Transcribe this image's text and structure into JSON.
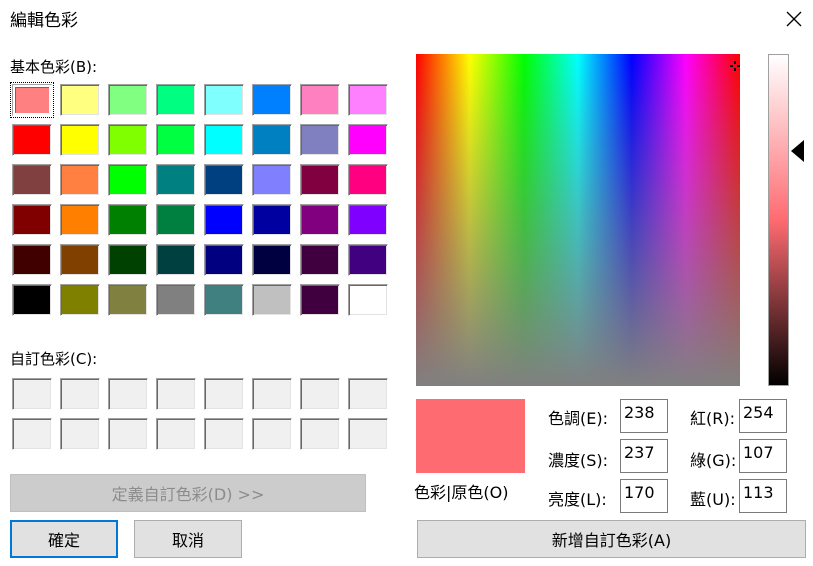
{
  "dialog": {
    "title": "編輯色彩"
  },
  "basic_colors": {
    "label": "基本色彩(B):",
    "rows": [
      [
        "#ff8080",
        "#ffff80",
        "#80ff80",
        "#00ff80",
        "#80ffff",
        "#0080ff",
        "#ff80c0",
        "#ff80ff"
      ],
      [
        "#ff0000",
        "#ffff00",
        "#80ff00",
        "#00ff40",
        "#00ffff",
        "#0080c0",
        "#8080c0",
        "#ff00ff"
      ],
      [
        "#804040",
        "#ff8040",
        "#00ff00",
        "#008080",
        "#004080",
        "#8080ff",
        "#800040",
        "#ff0080"
      ],
      [
        "#800000",
        "#ff8000",
        "#008000",
        "#008040",
        "#0000ff",
        "#0000a0",
        "#800080",
        "#8000ff"
      ],
      [
        "#400000",
        "#804000",
        "#004000",
        "#004040",
        "#000080",
        "#000040",
        "#400040",
        "#400080"
      ],
      [
        "#000000",
        "#808000",
        "#808040",
        "#808080",
        "#408080",
        "#c0c0c0",
        "#400040",
        "#ffffff"
      ]
    ],
    "selected": "#ff8080"
  },
  "custom_colors": {
    "label": "自訂色彩(C):",
    "rows": [
      [
        "#f0f0f0",
        "#f0f0f0",
        "#f0f0f0",
        "#f0f0f0",
        "#f0f0f0",
        "#f0f0f0",
        "#f0f0f0",
        "#f0f0f0"
      ],
      [
        "#f0f0f0",
        "#f0f0f0",
        "#f0f0f0",
        "#f0f0f0",
        "#f0f0f0",
        "#f0f0f0",
        "#f0f0f0",
        "#f0f0f0"
      ]
    ]
  },
  "buttons": {
    "define_custom": "定義自訂色彩(D) >>",
    "ok": "確定",
    "cancel": "取消",
    "add_custom": "新增自訂色彩(A)"
  },
  "preview": {
    "label": "色彩|原色(O)",
    "color": "#fe6b71"
  },
  "fields": {
    "hue": {
      "label": "色調(E):",
      "value": "238"
    },
    "sat": {
      "label": "濃度(S):",
      "value": "237"
    },
    "lum": {
      "label": "亮度(L):",
      "value": "170"
    },
    "red": {
      "label": "紅(R):",
      "value": "254"
    },
    "green": {
      "label": "綠(G):",
      "value": "107"
    },
    "blue": {
      "label": "藍(U):",
      "value": "113"
    }
  },
  "icons": {
    "close": "close-icon",
    "lum_arrow": "triangle-left-icon",
    "crosshair": "crosshair-icon"
  }
}
